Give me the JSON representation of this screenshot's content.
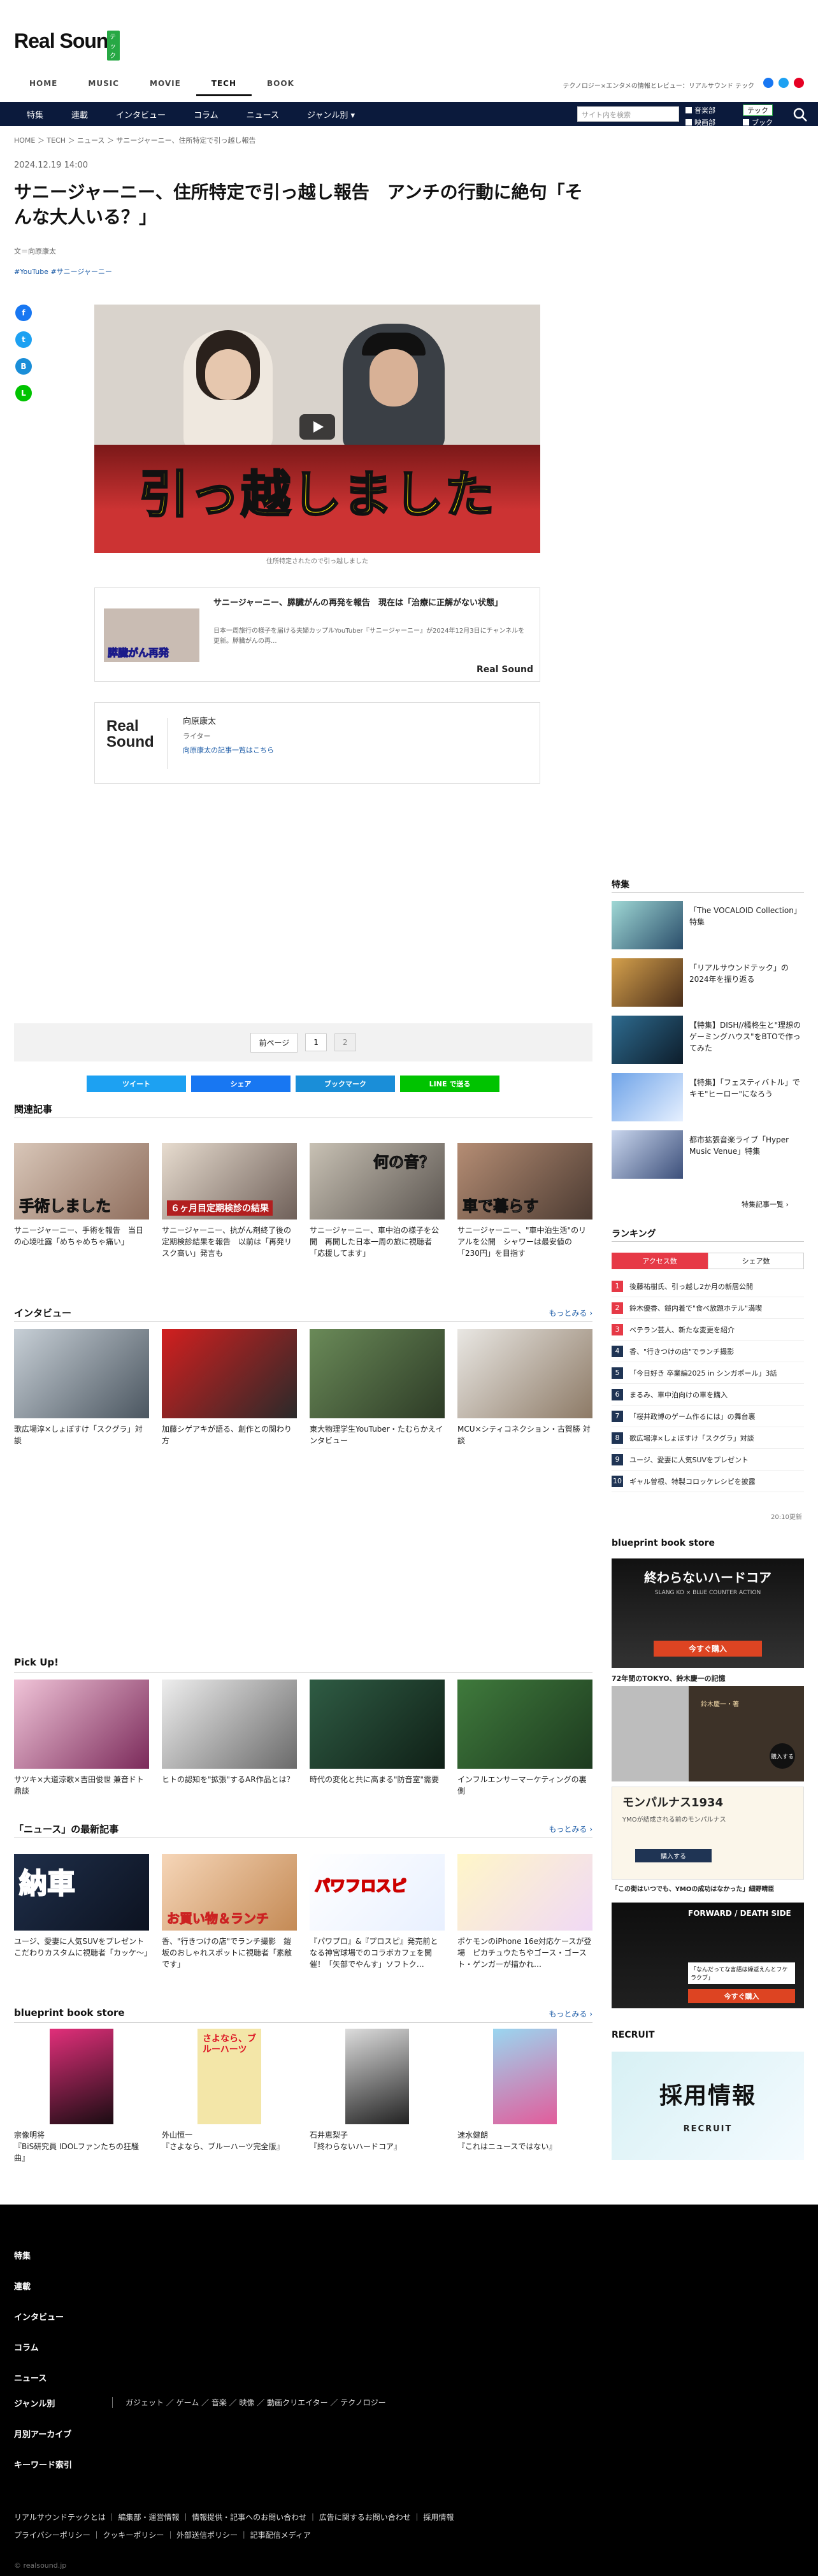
{
  "header": {
    "logo": "Real Sound",
    "logo_badge": "テック",
    "tagline": "テクノロジー×エンタメの情報とレビュー：リアルサウンド テック",
    "categories": [
      "HOME",
      "MUSIC",
      "MOVIE",
      "TECH",
      "BOOK"
    ],
    "subnav": [
      "特集",
      "連載",
      "インタビュー",
      "コラム",
      "ニュース",
      "ジャンル別 ▾"
    ],
    "search_placeholder": "サイト内を検索",
    "checks": [
      "音楽部",
      "テック",
      "映画部",
      "ブック"
    ]
  },
  "breadcrumb": "HOME ＞ TECH ＞ ニュース ＞ サニージャーニー、住所特定で引っ越し報告",
  "article": {
    "date": "2024.12.19 14:00",
    "title": "サニージャーニー、住所特定で引っ越し報告　アンチの行動に絶句「そんな大人いる？」",
    "author": "文＝向原康太",
    "tags": "#YouTube #サニージャーニー",
    "hero_text": "引っ越しました",
    "hero_caption": "住所特定されたので引っ越しました",
    "related": {
      "title": "サニージャーニー、膵臓がんの再発を報告　現在は「治療に正解がない状態」",
      "desc": "日本一周旅行の様子を届ける夫婦カップルYouTuber『サニージャーニー』が2024年12月3日にチャンネルを更新。膵臓がんの再...",
      "thumb_text": "膵臓がん再発",
      "logo": "Real Sound"
    },
    "author_card": {
      "logo": "Real Sound",
      "name": "向原康太",
      "role": "ライター",
      "link": "向原康太の記事一覧はこちら"
    }
  },
  "pager": {
    "prev": "前ページ",
    "p1": "1",
    "p2": "2"
  },
  "share": {
    "tweet": "ツイート",
    "share": "シェア",
    "bookmark": "ブックマーク",
    "line": "LINE で送る"
  },
  "related_articles": {
    "title": "関連記事",
    "items": [
      {
        "text": "サニージャーニー、手術を報告　当日の心境吐露「めちゃめちゃ痛い」",
        "overlay": "手術しました"
      },
      {
        "text": "サニージャーニー、抗がん剤終了後の定期検診結果を報告　以前は「再発リスク高い」発言も",
        "overlay": "６ヶ月目定期検診の結果"
      },
      {
        "text": "サニージャーニー、車中泊の様子を公開　再開した日本一周の旅に視聴者「応援してます」",
        "overlay": "何の音？"
      },
      {
        "text": "サニージャーニー、\"車中泊生活\"のリアルを公開　シャワーは最安値の「230円」を目指す",
        "overlay": "車で暮らす"
      }
    ]
  },
  "interview": {
    "title": "インタビュー",
    "more": "もっとみる ›",
    "items": [
      {
        "text": "歌広場淳×しょぼすけ「スクグラ」対談"
      },
      {
        "text": "加藤シゲアキが語る、創作との関わり方"
      },
      {
        "text": "東大物理学生YouTuber・たむらかえインタビュー"
      },
      {
        "text": "MCU×シティコネクション・古賀勝 対談"
      }
    ]
  },
  "pickup": {
    "title": "Pick Up!",
    "items": [
      {
        "text": "サツキ×大道涼歌×吉田俊世 兼音ドト鼎談"
      },
      {
        "text": "ヒトの認知を\"拡張\"するAR作品とは？"
      },
      {
        "text": "時代の変化と共に高まる\"防音室\"需要"
      },
      {
        "text": "インフルエンサーマーケティングの裏側"
      }
    ]
  },
  "news": {
    "title": "「ニュース」の最新記事",
    "more": "もっとみる ›",
    "items": [
      {
        "text": "ユージ、愛妻に人気SUVをプレゼント　こだわりカスタムに視聴者「カッケ～」",
        "overlay": "納車"
      },
      {
        "text": "香、\"行きつけの店\"でランチ撮影　鎧坂のおしゃれスポットに視聴者「素敵です」",
        "overlay": "お買い物＆ランチ"
      },
      {
        "text": "『パワプロ』&『プロスピ』発売前と なる神宮球場でのコラボカフェを開催！「矢部でやんす」ソフトク…",
        "overlay": "パワフロスピ"
      },
      {
        "text": "ポケモンのiPhone 16e対応ケースが登場　ピカチュウたちやゴース・ゴースト・ゲンガーが描かれ…",
        "overlay": ""
      }
    ]
  },
  "bp": {
    "title": "blueprint book store",
    "more": "もっとみる ›",
    "items": [
      {
        "text": "宗像明将\n『BiS研究員 IDOLファンたちの狂騒曲』"
      },
      {
        "text": "外山恒一\n『さよなら、ブルーハーツ完全版』",
        "cover": "さよなら、ブルーハーツ"
      },
      {
        "text": "石井恵梨子\n『終わらないハードコア』"
      },
      {
        "text": "速水健朗\n『これはニュースではない』"
      }
    ]
  },
  "sidebar": {
    "features_title": "特集",
    "features": [
      {
        "text": "「The VOCALOID Collection」特集"
      },
      {
        "text": "「リアルサウンドテック」の2024年を振り返る"
      },
      {
        "text": "【特集】DISH//橘柊生と\"理想のゲーミングハウス\"をBTOで作ってみた"
      },
      {
        "text": "【特集】「フェスティバトル」でキモ\"ヒーロー\"になろう"
      },
      {
        "text": "都市拡張音楽ライブ「Hyper Music Venue」特集"
      }
    ],
    "features_more": "特集記事一覧 ›",
    "ranking_title": "ランキング",
    "ranking_tabs": [
      "アクセス数",
      "シェア数"
    ],
    "ranking": [
      "後藤祐樹氏、引っ越し2か月の新居公開",
      "鈴木優香、鎧内着で\"食べ放題ホテル\"満喫",
      "ベテラン芸人、新たな変更を紹介",
      "香、\"行きつけの店\"でランチ撮影",
      "「今日好き 卒業編2025 in シンガポール」3話",
      "まるみ、車中泊向けの車を購入",
      "「桜井政博のゲーム作るには」の舞台裏",
      "歌広場淳×しょぼすけ「スクグラ」対談",
      "ユージ、愛妻に人気SUVをプレゼント",
      "ギャル曽根、特製コロッケレシピを披露"
    ],
    "ranking_more": "20:10更新",
    "bp_title": "blueprint book store",
    "bp1": {
      "headline": "終わらないハードコア",
      "sub": "SLANG KO × BLUE COUNTER ACTION",
      "btn": "今すぐ購入"
    },
    "bp2": {
      "head": "72年間のTOKYO、鈴木慶一の記憶",
      "sub": "鈴木慶一・著",
      "badge": "購入する"
    },
    "bp3": {
      "head": "モンパルナス1934",
      "sub": "YMOが結成される前のモンパルナス",
      "btn": "購入する",
      "cap": "「この街はいつでも、YMOの成功はなかった」細野晴臣"
    },
    "bp4": {
      "head": "FORWARD / DEATH SIDE",
      "sub": "「なんだってな言語は繰返えんとフケラクブ」",
      "btn": "今すぐ購入"
    },
    "recruit_title": "RECRUIT",
    "recruit_text": "採用情報",
    "recruit_sub": "RECRUIT"
  },
  "footer": {
    "items": [
      "特集",
      "連載",
      "インタビュー",
      "コラム",
      "ニュース",
      "ジャンル別",
      "月別アーカイブ",
      "キーワード索引"
    ],
    "genres": "ガジェット ／ ゲーム ／ 音楽 ／ 映像 ／ 動画クリエイター ／ テクノロジー",
    "links1": "リアルサウンドテックとは ｜ 編集部・運営情報 ｜ 情報提供・記事へのお問い合わせ ｜ 広告に関するお問い合わせ ｜ 採用情報",
    "links2": "プライバシーポリシー ｜ クッキーポリシー ｜ 外部送信ポリシー ｜ 記事配信メディア",
    "copyright": "© realsound.jp"
  },
  "colors": {
    "navy": "#0b1a3c",
    "accent": "#e63946",
    "green": "#27a844",
    "link": "#1a5aa6"
  }
}
